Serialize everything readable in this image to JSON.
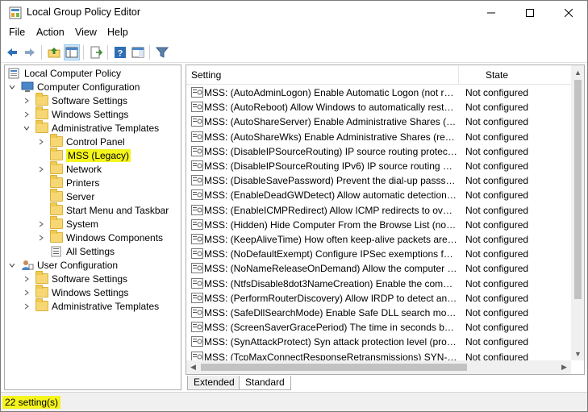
{
  "window": {
    "title": "Local Group Policy Editor",
    "icon": "gpedit-icon"
  },
  "menu": [
    "File",
    "Action",
    "View",
    "Help"
  ],
  "toolbar": {
    "buttons": [
      "back-icon",
      "forward-icon",
      "up-folder-icon",
      "show-hide-tree-icon",
      "export-list-icon",
      "help-icon",
      "properties-pane-icon",
      "filter-icon"
    ]
  },
  "tree": {
    "root": "Local Computer Policy",
    "computer_config": "Computer Configuration",
    "software_settings": "Software Settings",
    "windows_settings": "Windows Settings",
    "admin_templates": "Administrative Templates",
    "control_panel": "Control Panel",
    "mss_legacy": "MSS (Legacy)",
    "network": "Network",
    "printers": "Printers",
    "server": "Server",
    "start_menu": "Start Menu and Taskbar",
    "system": "System",
    "windows_components": "Windows Components",
    "all_settings": "All Settings",
    "user_config": "User Configuration",
    "user_software_settings": "Software Settings",
    "user_windows_settings": "Windows Settings",
    "user_admin_templates": "Administrative Templates",
    "highlight_color": "#f5f51e"
  },
  "list": {
    "columns": {
      "setting": "Setting",
      "state": "State"
    },
    "rows": [
      {
        "name": "MSS: (AutoAdminLogon) Enable Automatic Logon (not rec...",
        "state": "Not configured"
      },
      {
        "name": "MSS: (AutoReboot) Allow Windows to automatically restart ...",
        "state": "Not configured"
      },
      {
        "name": "MSS: (AutoShareServer) Enable Administrative Shares (reco...",
        "state": "Not configured"
      },
      {
        "name": "MSS: (AutoShareWks) Enable Administrative Shares (recom...",
        "state": "Not configured"
      },
      {
        "name": "MSS: (DisableIPSourceRouting) IP source routing protection ...",
        "state": "Not configured"
      },
      {
        "name": "MSS: (DisableIPSourceRouting IPv6) IP source routing prote...",
        "state": "Not configured"
      },
      {
        "name": "MSS: (DisableSavePassword) Prevent the dial-up passsword ...",
        "state": "Not configured"
      },
      {
        "name": "MSS: (EnableDeadGWDetect) Allow automatic detection of ...",
        "state": "Not configured"
      },
      {
        "name": "MSS: (EnableICMPRedirect) Allow ICMP redirects to override...",
        "state": "Not configured"
      },
      {
        "name": "MSS: (Hidden) Hide Computer From the Browse List (not re...",
        "state": "Not configured"
      },
      {
        "name": "MSS: (KeepAliveTime) How often keep-alive packets are sen...",
        "state": "Not configured"
      },
      {
        "name": "MSS: (NoDefaultExempt) Configure IPSec exemptions for va...",
        "state": "Not configured"
      },
      {
        "name": "MSS: (NoNameReleaseOnDemand) Allow the computer to i...",
        "state": "Not configured"
      },
      {
        "name": "MSS: (NtfsDisable8dot3NameCreation) Enable the computer...",
        "state": "Not configured"
      },
      {
        "name": "MSS: (PerformRouterDiscovery) Allow IRDP to detect and co...",
        "state": "Not configured"
      },
      {
        "name": "MSS: (SafeDllSearchMode) Enable Safe DLL search mode (re...",
        "state": "Not configured"
      },
      {
        "name": "MSS: (ScreenSaverGracePeriod) The time in seconds before t...",
        "state": "Not configured"
      },
      {
        "name": "MSS: (SynAttackProtect) Syn attack protection level (protect...",
        "state": "Not configured"
      },
      {
        "name": "MSS: (TcpMaxConnectResponseRetransmissions) SYN-ACK ...",
        "state": "Not configured"
      }
    ]
  },
  "tabs": [
    "Extended",
    "Standard"
  ],
  "status": {
    "text": "22 setting(s)"
  }
}
